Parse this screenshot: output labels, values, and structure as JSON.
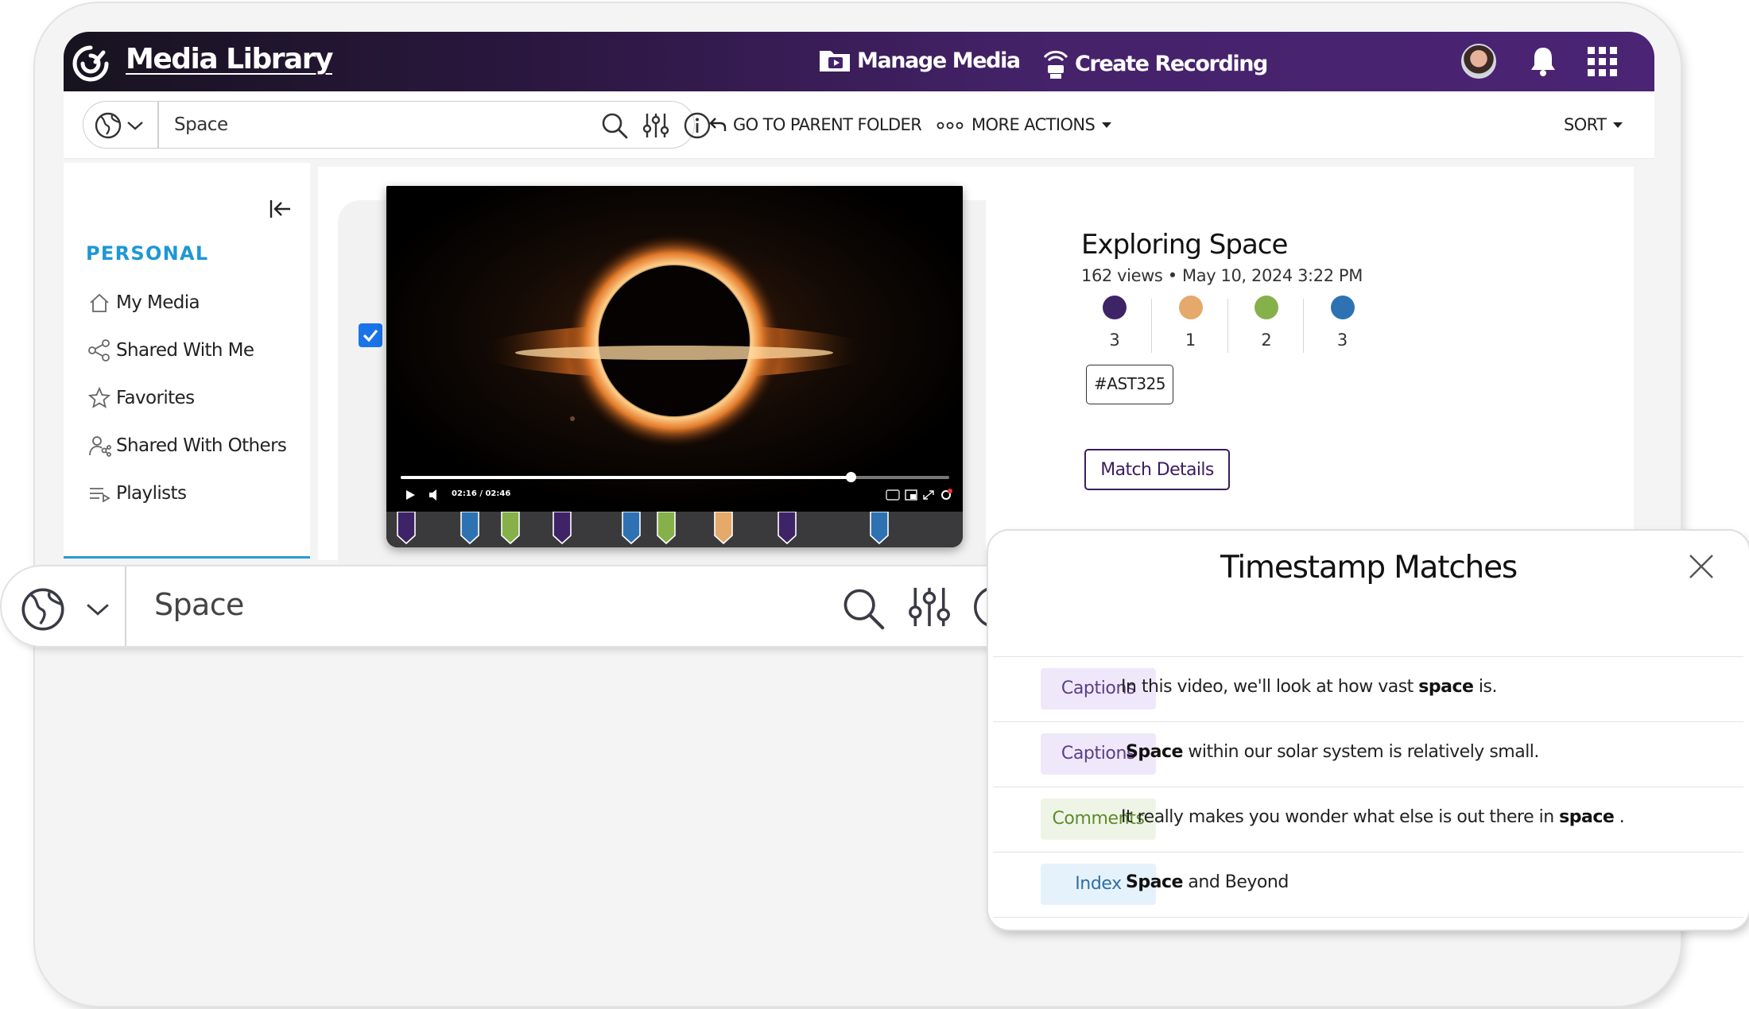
{
  "header": {
    "title": "Media Library",
    "manage_media": "Manage Media",
    "create_recording": "Create Recording",
    "brand_gradient": [
      "#17131f",
      "#4b2475"
    ]
  },
  "toolbar": {
    "search_value": "Space",
    "go_to_parent": "GO TO PARENT FOLDER",
    "more_actions": "MORE ACTIONS",
    "sort": "SORT"
  },
  "sidebar": {
    "section_title": "PERSONAL",
    "items": [
      {
        "label": "My Media",
        "icon": "home-icon"
      },
      {
        "label": "Shared With Me",
        "icon": "share-icon"
      },
      {
        "label": "Favorites",
        "icon": "star-icon"
      },
      {
        "label": "Shared With Others",
        "icon": "user-share-icon"
      },
      {
        "label": "Playlists",
        "icon": "playlist-icon"
      }
    ]
  },
  "video": {
    "title": "Exploring Space",
    "views": "162 views",
    "date": "May 10, 2024 3:22 PM",
    "time_display": "02:16 / 02:46",
    "progress": 0.82,
    "selected": true,
    "tag": "#AST325",
    "match_details": "Match Details",
    "stats": [
      {
        "color": "#3e2467",
        "count": "3"
      },
      {
        "color": "#e5a96b",
        "count": "1"
      },
      {
        "color": "#86b04a",
        "count": "2"
      },
      {
        "color": "#2e72b4",
        "count": "3"
      }
    ],
    "markers": [
      {
        "color": "#3e2467",
        "pos": 0.01
      },
      {
        "color": "#2e72b4",
        "pos": 0.12
      },
      {
        "color": "#86b04a",
        "pos": 0.19
      },
      {
        "color": "#3e2467",
        "pos": 0.28
      },
      {
        "color": "#2e72b4",
        "pos": 0.4
      },
      {
        "color": "#86b04a",
        "pos": 0.46
      },
      {
        "color": "#e5a96b",
        "pos": 0.56
      },
      {
        "color": "#3e2467",
        "pos": 0.67
      },
      {
        "color": "#2e72b4",
        "pos": 0.83
      }
    ]
  },
  "search_zoom": {
    "value": "Space"
  },
  "timestamp_matches": {
    "title": "Timestamp Matches",
    "rows": [
      {
        "type": "Captions",
        "text_before": "In this video, we'll look at how vast ",
        "match": "space",
        "text_after": " is.",
        "badge_bg": "#efe8fb",
        "badge_fg": "#5b3f86"
      },
      {
        "type": "Captions",
        "text_before": "",
        "match": "Space",
        "text_after": " within our solar system is relatively small.",
        "badge_bg": "#efe8fb",
        "badge_fg": "#5b3f86"
      },
      {
        "type": "Comments",
        "text_before": "It really makes you wonder what else is out there in ",
        "match": "space",
        "text_after": " .",
        "badge_bg": "#eff5e6",
        "badge_fg": "#5f8b2e"
      },
      {
        "type": "Index",
        "text_before": "",
        "match": "Space",
        "text_after": " and Beyond",
        "badge_bg": "#e6f2fb",
        "badge_fg": "#2e6fa6"
      }
    ]
  }
}
